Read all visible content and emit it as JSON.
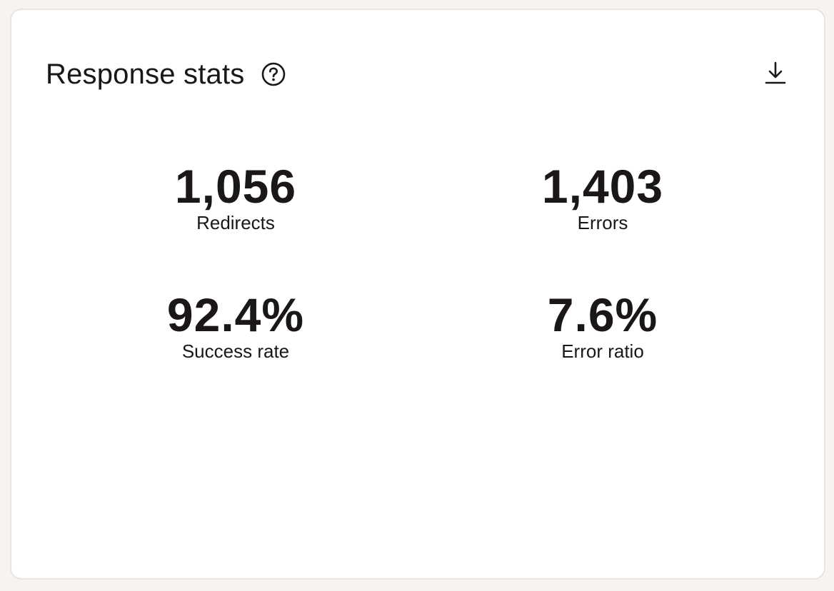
{
  "card": {
    "title": "Response stats",
    "help_icon": "help-circle-icon",
    "download_icon": "download-icon"
  },
  "stats": [
    {
      "value": "1,056",
      "label": "Redirects"
    },
    {
      "value": "1,403",
      "label": "Errors"
    },
    {
      "value": "92.4%",
      "label": "Success rate"
    },
    {
      "value": "7.6%",
      "label": "Error ratio"
    }
  ],
  "colors": {
    "text": "#1a1716",
    "card_border": "#ebe4df",
    "page_background": "#f7f3ef"
  }
}
